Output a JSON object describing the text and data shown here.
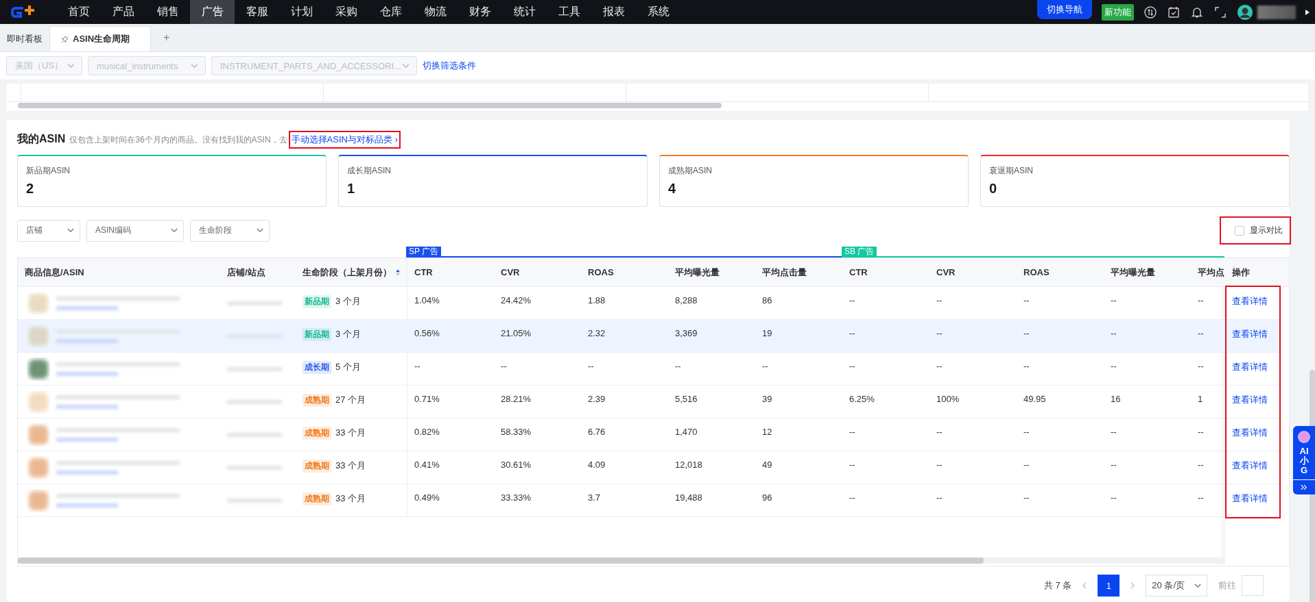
{
  "nav": {
    "items": [
      {
        "label": "首页",
        "selected": false
      },
      {
        "label": "产品",
        "selected": false
      },
      {
        "label": "销售",
        "selected": false
      },
      {
        "label": "广告",
        "selected": true
      },
      {
        "label": "客服",
        "selected": false
      },
      {
        "label": "计划",
        "selected": false
      },
      {
        "label": "采购",
        "selected": false
      },
      {
        "label": "仓库",
        "selected": false
      },
      {
        "label": "物流",
        "selected": false
      },
      {
        "label": "财务",
        "selected": false
      },
      {
        "label": "统计",
        "selected": false
      },
      {
        "label": "工具",
        "selected": false
      },
      {
        "label": "报表",
        "selected": false
      },
      {
        "label": "系统",
        "selected": false
      }
    ],
    "switch_button": "切换导航",
    "new_badge": "新功能"
  },
  "tabs": [
    {
      "label": "即时看板",
      "selected": false,
      "pinned": false
    },
    {
      "label": "ASIN生命周期",
      "selected": true,
      "pinned": true
    }
  ],
  "add_tab": "+",
  "filters": [
    {
      "value": "美国（US）",
      "disabled": true
    },
    {
      "value": "musical_instruments",
      "disabled": true
    },
    {
      "value": "INSTRUMENT_PARTS_AND_ACCESSORI...",
      "disabled": true
    }
  ],
  "filter_link": "切换筛选条件",
  "section": {
    "title": "我的ASIN",
    "note": "仅包含上架时间在36个月内的商品。没有找到我的ASIN，去",
    "link": {
      "label": "手动选择ASIN与对标品类 ›",
      "highlighted": true
    }
  },
  "stage_cards": [
    {
      "label": "新品期ASIN",
      "count": "2",
      "color": "#1ec9a0"
    },
    {
      "label": "成长期ASIN",
      "count": "1",
      "color": "#1a4ff0"
    },
    {
      "label": "成熟期ASIN",
      "count": "4",
      "color": "#f57c1f"
    },
    {
      "label": "衰退期ASIN",
      "count": "0",
      "color": "#ee2a2a"
    }
  ],
  "table_filters": [
    {
      "placeholder": "店铺"
    },
    {
      "placeholder": "ASIN编码"
    },
    {
      "placeholder": "生命阶段"
    }
  ],
  "compare_toggle": {
    "label": "显示对比",
    "checked": false,
    "highlighted": true
  },
  "table": {
    "columns": [
      "商品信息/ASIN",
      "店铺/站点",
      "生命阶段（上架月份）"
    ],
    "groups": [
      {
        "label": "SP 广告",
        "color": "#1a4ff0",
        "columns": [
          "CTR",
          "CVR",
          "ROAS",
          "平均曝光量",
          "平均点击量"
        ]
      },
      {
        "label": "SB 广告",
        "color": "#14c9a0",
        "columns": [
          "CTR",
          "CVR",
          "ROAS",
          "平均曝光量",
          "平均点"
        ]
      }
    ],
    "action_column": "操作",
    "actions_highlighted": true,
    "rows": [
      {
        "stage": "新品期",
        "color": "#14b88f",
        "months": "3 个月",
        "sp": [
          "1.04%",
          "24.42%",
          "1.88",
          "8,288",
          "86"
        ],
        "sb": [
          "--",
          "--",
          "--",
          "--",
          "--"
        ],
        "action": "查看详情",
        "selected": false
      },
      {
        "stage": "新品期",
        "color": "#14b88f",
        "months": "3 个月",
        "sp": [
          "0.56%",
          "21.05%",
          "2.32",
          "3,369",
          "19"
        ],
        "sb": [
          "--",
          "--",
          "--",
          "--",
          "--"
        ],
        "action": "查看详情",
        "selected": true
      },
      {
        "stage": "成长期",
        "color": "#2a5cf0",
        "months": "5 个月",
        "sp": [
          "--",
          "--",
          "--",
          "--",
          "--"
        ],
        "sb": [
          "--",
          "--",
          "--",
          "--",
          "--"
        ],
        "action": "查看详情",
        "selected": false
      },
      {
        "stage": "成熟期",
        "color": "#f07a1a",
        "months": "27 个月",
        "sp": [
          "0.71%",
          "28.21%",
          "2.39",
          "5,516",
          "39"
        ],
        "sb": [
          "6.25%",
          "100%",
          "49.95",
          "16",
          "1"
        ],
        "action": "查看详情",
        "selected": false
      },
      {
        "stage": "成熟期",
        "color": "#f07a1a",
        "months": "33 个月",
        "sp": [
          "0.82%",
          "58.33%",
          "6.76",
          "1,470",
          "12"
        ],
        "sb": [
          "--",
          "--",
          "--",
          "--",
          "--"
        ],
        "action": "查看详情",
        "selected": false
      },
      {
        "stage": "成熟期",
        "color": "#f07a1a",
        "months": "33 个月",
        "sp": [
          "0.41%",
          "30.61%",
          "4.09",
          "12,018",
          "49"
        ],
        "sb": [
          "--",
          "--",
          "--",
          "--",
          "--"
        ],
        "action": "查看详情",
        "selected": false
      },
      {
        "stage": "成熟期",
        "color": "#f07a1a",
        "months": "33 个月",
        "sp": [
          "0.49%",
          "33.33%",
          "3.7",
          "19,488",
          "96"
        ],
        "sb": [
          "--",
          "--",
          "--",
          "--",
          "--"
        ],
        "action": "查看详情",
        "selected": false
      }
    ]
  },
  "pagination": {
    "total": "共 7 条",
    "pages": [
      {
        "label": "1",
        "selected": true
      }
    ],
    "page_size": "20 条/页",
    "goto_label": "前往"
  },
  "ai_widget": {
    "lines": [
      "AI",
      "小",
      "G"
    ]
  }
}
